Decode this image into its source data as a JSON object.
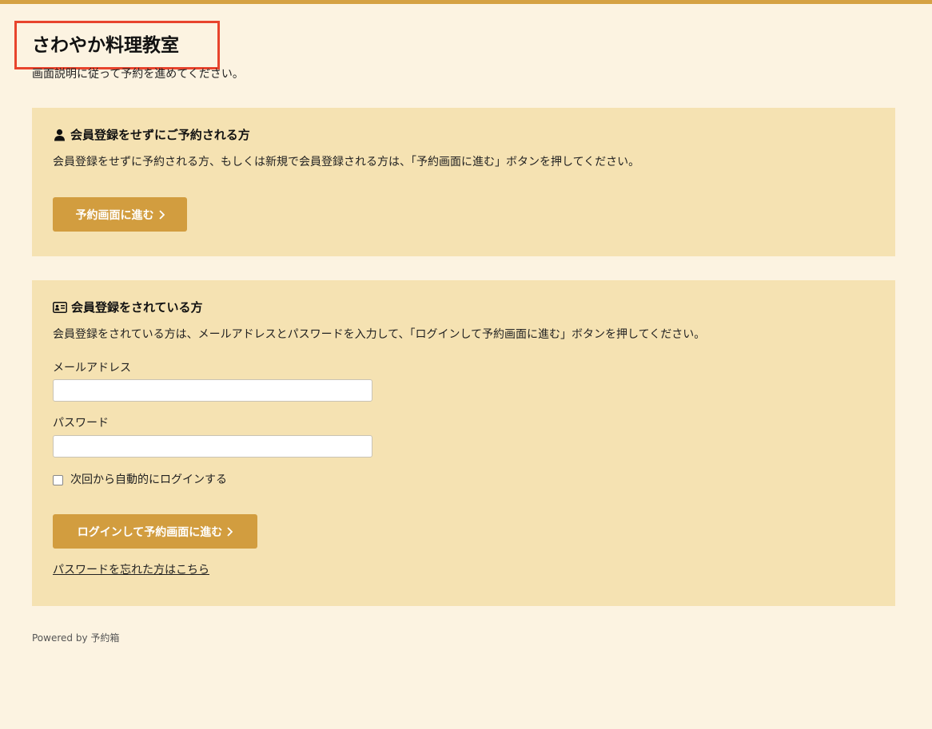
{
  "site": {
    "title": "さわやか料理教室",
    "intro": "画面説明に従って予約を進めてください。"
  },
  "guest": {
    "heading": "会員登録をせずにご予約される方",
    "heading_icon": "user-icon",
    "description": "会員登録をせずに予約される方、もしくは新規で会員登録される方は、「予約画面に進む」ボタンを押してください。",
    "button_label": "予約画面に進む"
  },
  "member": {
    "heading": "会員登録をされている方",
    "heading_icon": "id-card-icon",
    "description": "会員登録をされている方は、メールアドレスとパスワードを入力して、「ログインして予約画面に進む」ボタンを押してください。",
    "email_label": "メールアドレス",
    "email_value": "",
    "password_label": "パスワード",
    "password_value": "",
    "remember_label": "次回から自動的にログインする",
    "remember_checked": false,
    "login_button_label": "ログインして予約画面に進む",
    "forgot_link": "パスワードを忘れた方はこちら"
  },
  "footer": {
    "powered_by": "Powered by 予約箱"
  },
  "colors": {
    "background": "#fcf3e1",
    "panel": "#f5e2b2",
    "accent": "#d29d3f",
    "top_bar": "#d5a143",
    "highlight_border": "#e8442d"
  }
}
